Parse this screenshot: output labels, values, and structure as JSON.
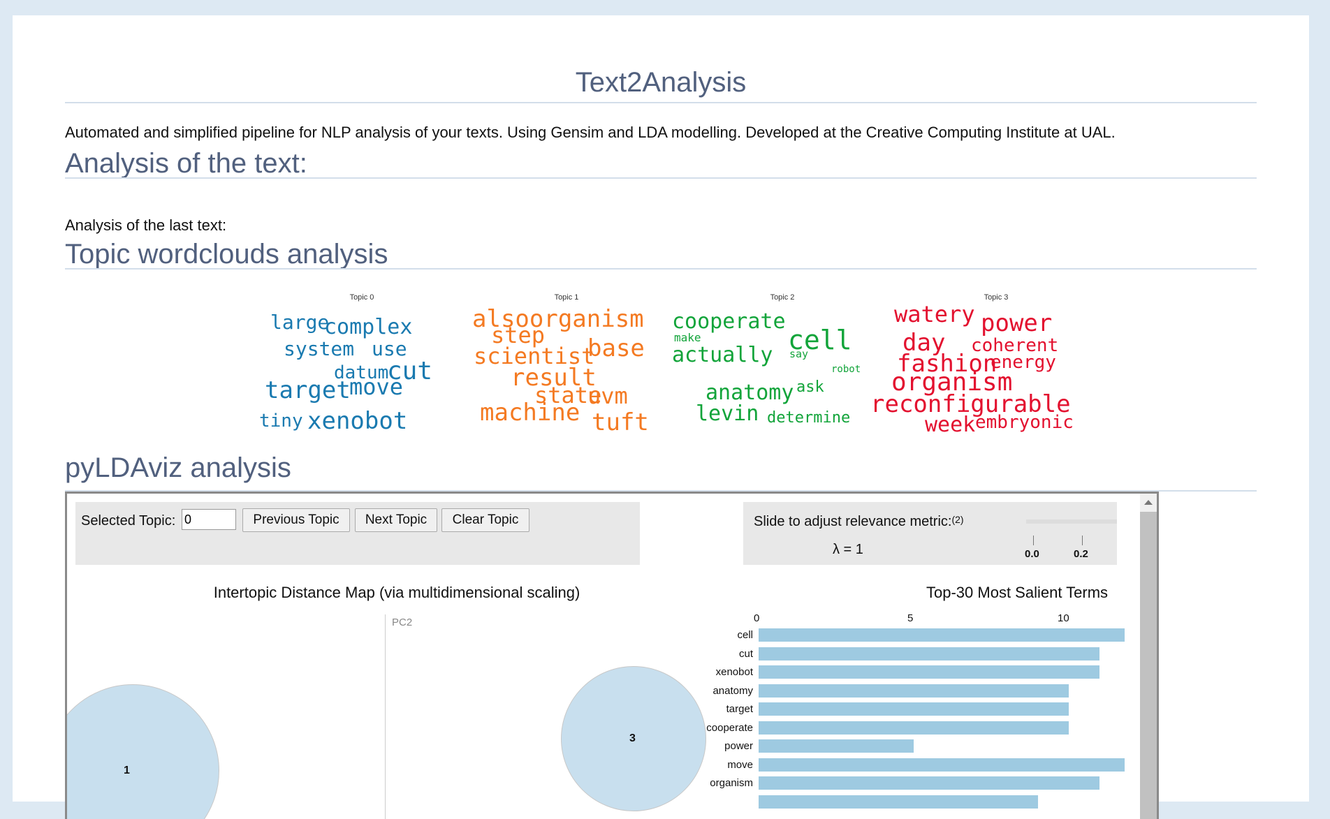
{
  "app": {
    "title": "Text2Analysis",
    "description": "Automated and simplified pipeline for NLP analysis of your texts. Using Gensim and LDA modelling. Developed at the Creative Computing Institute at UAL."
  },
  "sections": {
    "analysis_heading": "Analysis of the text:",
    "last_text_label": "Analysis of the last text:",
    "wordclouds_heading": "Topic wordclouds analysis",
    "pyldaviz_heading": "pyLDAviz analysis"
  },
  "wordclouds": [
    {
      "title": "Topic 0",
      "color": "#1a7ab0",
      "words": [
        "large",
        "complex",
        "system",
        "use",
        "datum",
        "cut",
        "target",
        "move",
        "tiny",
        "xenobot"
      ]
    },
    {
      "title": "Topic 1",
      "color": "#f47a22",
      "words": [
        "alsoorganism",
        "step",
        "scientist",
        "base",
        "result",
        "state",
        "uvm",
        "machine",
        "tuft"
      ]
    },
    {
      "title": "Topic 2",
      "color": "#12a43a",
      "words": [
        "cooperate",
        "make",
        "cell",
        "actually",
        "say",
        "robot",
        "anatomy",
        "ask",
        "levin",
        "determine"
      ]
    },
    {
      "title": "Topic 3",
      "color": "#e3112f",
      "words": [
        "watery",
        "power",
        "day",
        "coherent",
        "fashion",
        "energy",
        "organism",
        "reconfigurable",
        "week",
        "embryonic"
      ]
    }
  ],
  "ldaviz": {
    "selected_topic_label": "Selected Topic:",
    "selected_topic_value": "0",
    "prev_button": "Previous Topic",
    "next_button": "Next Topic",
    "clear_button": "Clear Topic",
    "relevance_label": "Slide to adjust relevance metric:",
    "relevance_sup": "(2)",
    "lambda_text": "λ = 1",
    "slider_ticks": [
      "0.0",
      "0.2"
    ],
    "map_title": "Intertopic Distance Map (via multidimensional scaling)",
    "pc2_label": "PC2",
    "topic_circles": [
      "1",
      "3"
    ],
    "bar_title": "Top-30 Most Salient Terms",
    "chart_data": {
      "type": "bar",
      "orientation": "horizontal",
      "title": "Top-30 Most Salient Terms",
      "x_ticks": [
        "0",
        "5",
        "10"
      ],
      "categories": [
        "cell",
        "cut",
        "xenobot",
        "anatomy",
        "target",
        "cooperate",
        "power",
        "move",
        "organism",
        ""
      ],
      "values": [
        11.8,
        11,
        11,
        10,
        10,
        10,
        5,
        11.8,
        11,
        9
      ]
    }
  }
}
